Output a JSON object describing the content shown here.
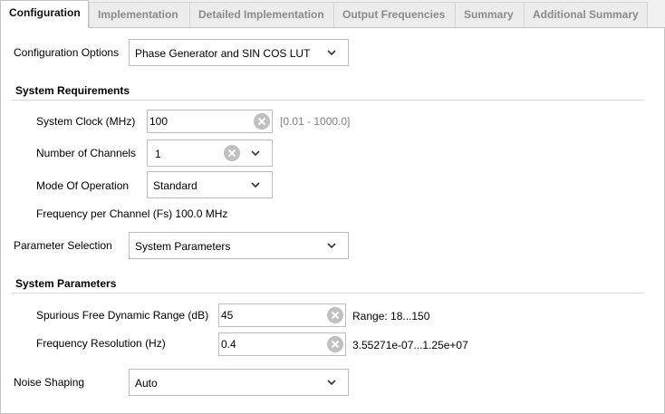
{
  "tabs": [
    {
      "label": "Configuration",
      "active": true
    },
    {
      "label": "Implementation",
      "active": false
    },
    {
      "label": "Detailed Implementation",
      "active": false
    },
    {
      "label": "Output Frequencies",
      "active": false
    },
    {
      "label": "Summary",
      "active": false
    },
    {
      "label": "Additional Summary",
      "active": false
    }
  ],
  "config_options": {
    "label": "Configuration Options",
    "value": "Phase Generator and SIN COS LUT"
  },
  "system_requirements": {
    "title": "System Requirements",
    "system_clock": {
      "label": "System Clock (MHz)",
      "value": "100",
      "range": "[0.01 - 1000.0]"
    },
    "num_channels": {
      "label": "Number of Channels",
      "value": "1"
    },
    "mode": {
      "label": "Mode Of Operation",
      "value": "Standard"
    },
    "freq_per_channel": "Frequency per Channel (Fs) 100.0 MHz"
  },
  "parameter_selection": {
    "label": "Parameter Selection",
    "value": "System Parameters"
  },
  "system_parameters": {
    "title": "System Parameters",
    "sfdr": {
      "label": "Spurious Free Dynamic Range (dB)",
      "value": "45",
      "range": "Range: 18...150"
    },
    "freq_res": {
      "label": "Frequency Resolution (Hz)",
      "value": "0.4",
      "range": "3.55271e-07...1.25e+07"
    }
  },
  "noise_shaping": {
    "label": "Noise Shaping",
    "value": "Auto"
  },
  "colors": {
    "clear_icon": "#c0c0c0",
    "tab_inactive_text": "#8a8a8a",
    "hint_text": "#808080"
  }
}
